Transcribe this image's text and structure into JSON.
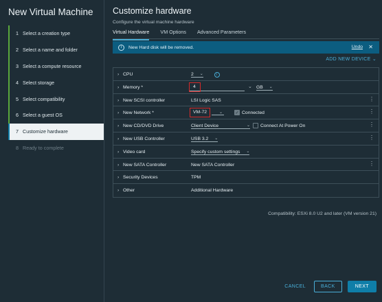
{
  "wizard": {
    "title": "New Virtual Machine",
    "steps": [
      {
        "num": "1",
        "label": "Select a creation type"
      },
      {
        "num": "2",
        "label": "Select a name and folder"
      },
      {
        "num": "3",
        "label": "Select a compute resource"
      },
      {
        "num": "4",
        "label": "Select storage"
      },
      {
        "num": "5",
        "label": "Select compatibility"
      },
      {
        "num": "6",
        "label": "Select a guest OS"
      },
      {
        "num": "7",
        "label": "Customize hardware"
      },
      {
        "num": "8",
        "label": "Ready to complete"
      }
    ]
  },
  "main": {
    "title": "Customize hardware",
    "subtitle": "Configure the virtual machine hardware",
    "tabs": [
      "Virtual Hardware",
      "VM Options",
      "Advanced Parameters"
    ],
    "banner": {
      "text": "New Hard disk will be removed.",
      "undo": "Undo",
      "close": "✕"
    },
    "add_device": "ADD NEW DEVICE ⌄"
  },
  "hardware": {
    "cpu": {
      "label": "CPU",
      "value": "2"
    },
    "memory": {
      "label": "Memory *",
      "value": "4",
      "unit": "GB"
    },
    "scsi": {
      "label": "New SCSI controller",
      "value": "LSI Logic SAS"
    },
    "network": {
      "label": "New Network *",
      "value": "VM-72",
      "connected": "Connected"
    },
    "cd": {
      "label": "New CD/DVD Drive",
      "value": "Client Device",
      "connect_power": "Connect At Power On"
    },
    "usb": {
      "label": "New USB Controller",
      "value": "USB 3.2"
    },
    "video": {
      "label": "Video card",
      "value": "Specify custom settings"
    },
    "sata": {
      "label": "New SATA Controller",
      "value": "New SATA Controller"
    },
    "security": {
      "label": "Security Devices",
      "value": "TPM"
    },
    "other": {
      "label": "Other",
      "value": "Additional Hardware"
    }
  },
  "compatibility": "Compatibility: ESXi 8.0 U2 and later (VM version 21)",
  "footer": {
    "cancel": "CANCEL",
    "back": "BACK",
    "next": "NEXT"
  },
  "colors": {
    "accent": "#49afd9",
    "primary": "#0f7ea8",
    "banner": "#0c5d80",
    "complete": "#5aa83c",
    "highlight": "#d62a2a"
  }
}
